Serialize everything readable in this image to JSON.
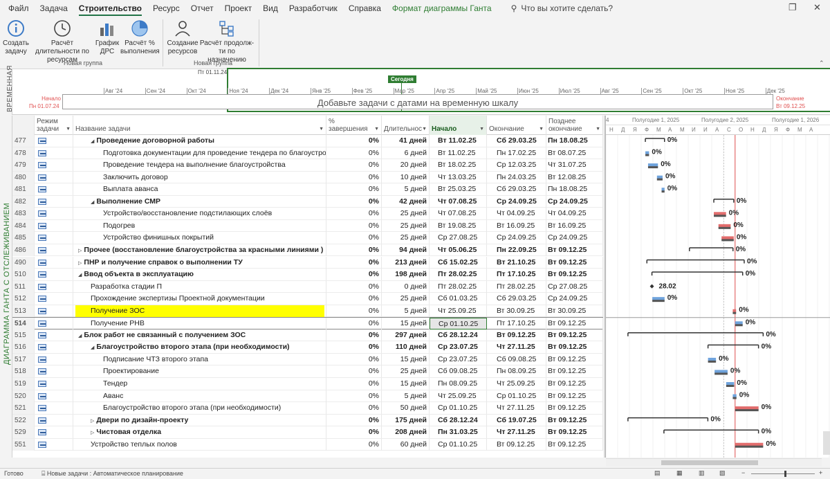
{
  "menu": {
    "items": [
      "Файл",
      "Задача",
      "Строительство",
      "Ресурс",
      "Отчет",
      "Проект",
      "Вид",
      "Разработчик",
      "Справка",
      "Формат диаграммы Ганта"
    ],
    "active_index": 2,
    "tell_me": "Что вы хотите сделать?"
  },
  "ribbon": {
    "buttons": [
      {
        "label": "Создать задачу",
        "icon": "info-icon"
      },
      {
        "label": "Расчёт длительности по ресурсам",
        "icon": "clock-icon"
      },
      {
        "label": "График ДРС",
        "icon": "bar-chart-icon"
      },
      {
        "label": "Расчёт % выполнения",
        "icon": "pie-chart-icon"
      },
      {
        "label": "Создание ресурсов",
        "icon": "person-icon"
      },
      {
        "label": "Расчёт продолж-ти по назначению",
        "icon": "hierarchy-icon"
      }
    ],
    "groups": [
      "Новая группа",
      "Новая группа"
    ]
  },
  "timeline": {
    "vertical_label": "ВРЕМЕННАЯ",
    "top_date": "Пт 01.11.24",
    "start_label": "Начало",
    "start_date": "Пн 01.07.24",
    "end_label": "Окончание",
    "end_date": "Вт 09.12.25",
    "today_label": "Сегодня",
    "placeholder": "Добавьте задачи с датами на временную шкалу",
    "months": [
      "Авг '24",
      "Сен '24",
      "Окт '24",
      "Ноя '24",
      "Дек '24",
      "Янв '25",
      "Фев '25",
      "Мар '25",
      "Апр '25",
      "Май '25",
      "Июн '25",
      "Июл '25",
      "Авг '25",
      "Сен '25",
      "Окт '25",
      "Ноя '25",
      "Дек '25"
    ]
  },
  "view_label": "ДИАГРАММА ГАНТА С ОТСЛЕЖИВАНИЕМ",
  "columns": {
    "mode": "Режим задачи",
    "name": "Название задачи",
    "pct": "% завершения",
    "dur": "Длительнос",
    "start": "Начало",
    "end": "Окончание",
    "late": "Позднее окончание"
  },
  "rows": [
    {
      "id": "477",
      "indent": 1,
      "summary": true,
      "expanded": true,
      "name": "Проведение договорной работы",
      "pct": "0%",
      "dur": "41 дней",
      "start": "Вт 11.02.25",
      "end": "Сб 29.03.25",
      "late": "Пн 18.08.25"
    },
    {
      "id": "478",
      "indent": 2,
      "name": "Подготовка документации для проведение тендера по благоустройству",
      "pct": "0%",
      "dur": "6 дней",
      "start": "Вт 11.02.25",
      "end": "Пн 17.02.25",
      "late": "Вт 08.07.25"
    },
    {
      "id": "479",
      "indent": 2,
      "name": "Проведение тендера на выполнение благоустройства",
      "pct": "0%",
      "dur": "20 дней",
      "start": "Вт 18.02.25",
      "end": "Ср 12.03.25",
      "late": "Чт 31.07.25"
    },
    {
      "id": "480",
      "indent": 2,
      "name": "Заключить договор",
      "pct": "0%",
      "dur": "10 дней",
      "start": "Чт 13.03.25",
      "end": "Пн 24.03.25",
      "late": "Вт 12.08.25"
    },
    {
      "id": "481",
      "indent": 2,
      "name": "Выплата аванса",
      "pct": "0%",
      "dur": "5 дней",
      "start": "Вт 25.03.25",
      "end": "Сб 29.03.25",
      "late": "Пн 18.08.25"
    },
    {
      "id": "482",
      "indent": 1,
      "summary": true,
      "expanded": true,
      "name": "Выполнение СМР",
      "pct": "0%",
      "dur": "42 дней",
      "start": "Чт 07.08.25",
      "end": "Ср 24.09.25",
      "late": "Ср 24.09.25"
    },
    {
      "id": "483",
      "indent": 2,
      "name": "Устройство/восстановление подстилающих слоёв",
      "pct": "0%",
      "dur": "25 дней",
      "start": "Чт 07.08.25",
      "end": "Чт 04.09.25",
      "late": "Чт 04.09.25"
    },
    {
      "id": "484",
      "indent": 2,
      "name": "Подогрев",
      "pct": "0%",
      "dur": "25 дней",
      "start": "Вт 19.08.25",
      "end": "Вт 16.09.25",
      "late": "Вт 16.09.25"
    },
    {
      "id": "485",
      "indent": 2,
      "name": "Устройство финишных покрытий",
      "pct": "0%",
      "dur": "25 дней",
      "start": "Ср 27.08.25",
      "end": "Ср 24.09.25",
      "late": "Ср 24.09.25"
    },
    {
      "id": "486",
      "indent": 0,
      "summary": true,
      "expanded": false,
      "name": "Прочее (восстановление благоустройства за красными линиями )",
      "pct": "0%",
      "dur": "94 дней",
      "start": "Чт 05.06.25",
      "end": "Пн 22.09.25",
      "late": "Вт 09.12.25"
    },
    {
      "id": "490",
      "indent": 0,
      "summary": true,
      "expanded": false,
      "name": "ПНР и получение справок о выполнении ТУ",
      "pct": "0%",
      "dur": "213 дней",
      "start": "Сб 15.02.25",
      "end": "Вт 21.10.25",
      "late": "Вт 09.12.25"
    },
    {
      "id": "510",
      "indent": 0,
      "summary": true,
      "expanded": true,
      "name": "Ввод объекта в эксплуатацию",
      "pct": "0%",
      "dur": "198 дней",
      "start": "Пт 28.02.25",
      "end": "Пт 17.10.25",
      "late": "Вт 09.12.25"
    },
    {
      "id": "511",
      "indent": 1,
      "name": "Разработка стадии П",
      "pct": "0%",
      "dur": "0 дней",
      "start": "Пт 28.02.25",
      "end": "Пт 28.02.25",
      "late": "Ср 27.08.25"
    },
    {
      "id": "512",
      "indent": 1,
      "name": "Прохождение экспертизы Проектной документации",
      "pct": "0%",
      "dur": "25 дней",
      "start": "Сб 01.03.25",
      "end": "Сб 29.03.25",
      "late": "Ср 24.09.25"
    },
    {
      "id": "513",
      "indent": 1,
      "highlight": true,
      "name": "Получение ЗОС",
      "pct": "0%",
      "dur": "5 дней",
      "start": "Чт 25.09.25",
      "end": "Вт 30.09.25",
      "late": "Вт 30.09.25"
    },
    {
      "id": "514",
      "indent": 1,
      "selected": true,
      "name": "Получение РНВ",
      "pct": "0%",
      "dur": "15 дней",
      "start": "Ср 01.10.25",
      "end": "Пт 17.10.25",
      "late": "Вт 09.12.25"
    },
    {
      "id": "515",
      "indent": 0,
      "summary": true,
      "expanded": true,
      "name": "Блок работ не связанный с получением ЗОС",
      "pct": "0%",
      "dur": "297 дней",
      "start": "Сб 28.12.24",
      "end": "Вт 09.12.25",
      "late": "Вт 09.12.25"
    },
    {
      "id": "516",
      "indent": 1,
      "summary": true,
      "expanded": true,
      "name": "Благоустройство второго этапа (при необходимости)",
      "pct": "0%",
      "dur": "110 дней",
      "start": "Ср 23.07.25",
      "end": "Чт 27.11.25",
      "late": "Вт 09.12.25"
    },
    {
      "id": "517",
      "indent": 2,
      "name": "Подписание ЧТЗ второго этапа",
      "pct": "0%",
      "dur": "15 дней",
      "start": "Ср 23.07.25",
      "end": "Сб 09.08.25",
      "late": "Вт 09.12.25"
    },
    {
      "id": "518",
      "indent": 2,
      "name": "Проектирование",
      "pct": "0%",
      "dur": "25 дней",
      "start": "Сб 09.08.25",
      "end": "Пн 08.09.25",
      "late": "Вт 09.12.25"
    },
    {
      "id": "519",
      "indent": 2,
      "name": "Тендер",
      "pct": "0%",
      "dur": "15 дней",
      "start": "Пн 08.09.25",
      "end": "Чт 25.09.25",
      "late": "Вт 09.12.25"
    },
    {
      "id": "520",
      "indent": 2,
      "name": "Аванс",
      "pct": "0%",
      "dur": "5 дней",
      "start": "Чт 25.09.25",
      "end": "Ср 01.10.25",
      "late": "Вт 09.12.25"
    },
    {
      "id": "521",
      "indent": 2,
      "name": "Благоустройство второго этапа (при необходимости)",
      "pct": "0%",
      "dur": "50 дней",
      "start": "Ср 01.10.25",
      "end": "Чт 27.11.25",
      "late": "Вт 09.12.25"
    },
    {
      "id": "522",
      "indent": 1,
      "summary": true,
      "expanded": false,
      "name": "Двери по дизайн-проекту",
      "pct": "0%",
      "dur": "175 дней",
      "start": "Сб 28.12.24",
      "end": "Сб 19.07.25",
      "late": "Вт 09.12.25"
    },
    {
      "id": "529",
      "indent": 1,
      "summary": true,
      "expanded": false,
      "name": "Чистовая отделка",
      "pct": "0%",
      "dur": "208 дней",
      "start": "Пн 31.03.25",
      "end": "Чт 27.11.25",
      "late": "Вт 09.12.25"
    },
    {
      "id": "551",
      "indent": 1,
      "name": "Устройство теплых полов",
      "pct": "0%",
      "dur": "60 дней",
      "start": "Ср 01.10.25",
      "end": "Вт 09.12.25",
      "late": "Вт 09.12.25"
    }
  ],
  "gantt": {
    "header_top": [
      "4",
      "Полугодие 1, 2025",
      "Полугодие 2, 2025",
      "Полугодие 1, 2026"
    ],
    "header_months": [
      "Н",
      "Д",
      "Я",
      "Ф",
      "М",
      "А",
      "М",
      "И",
      "И",
      "А",
      "С",
      "О",
      "Н",
      "Д",
      "Я",
      "Ф",
      "М",
      "А"
    ],
    "milestone_label": "28.02",
    "pct_label": "0%"
  },
  "status": {
    "ready": "Готово",
    "new_tasks": "Новые задачи : Автоматическое планирование"
  }
}
